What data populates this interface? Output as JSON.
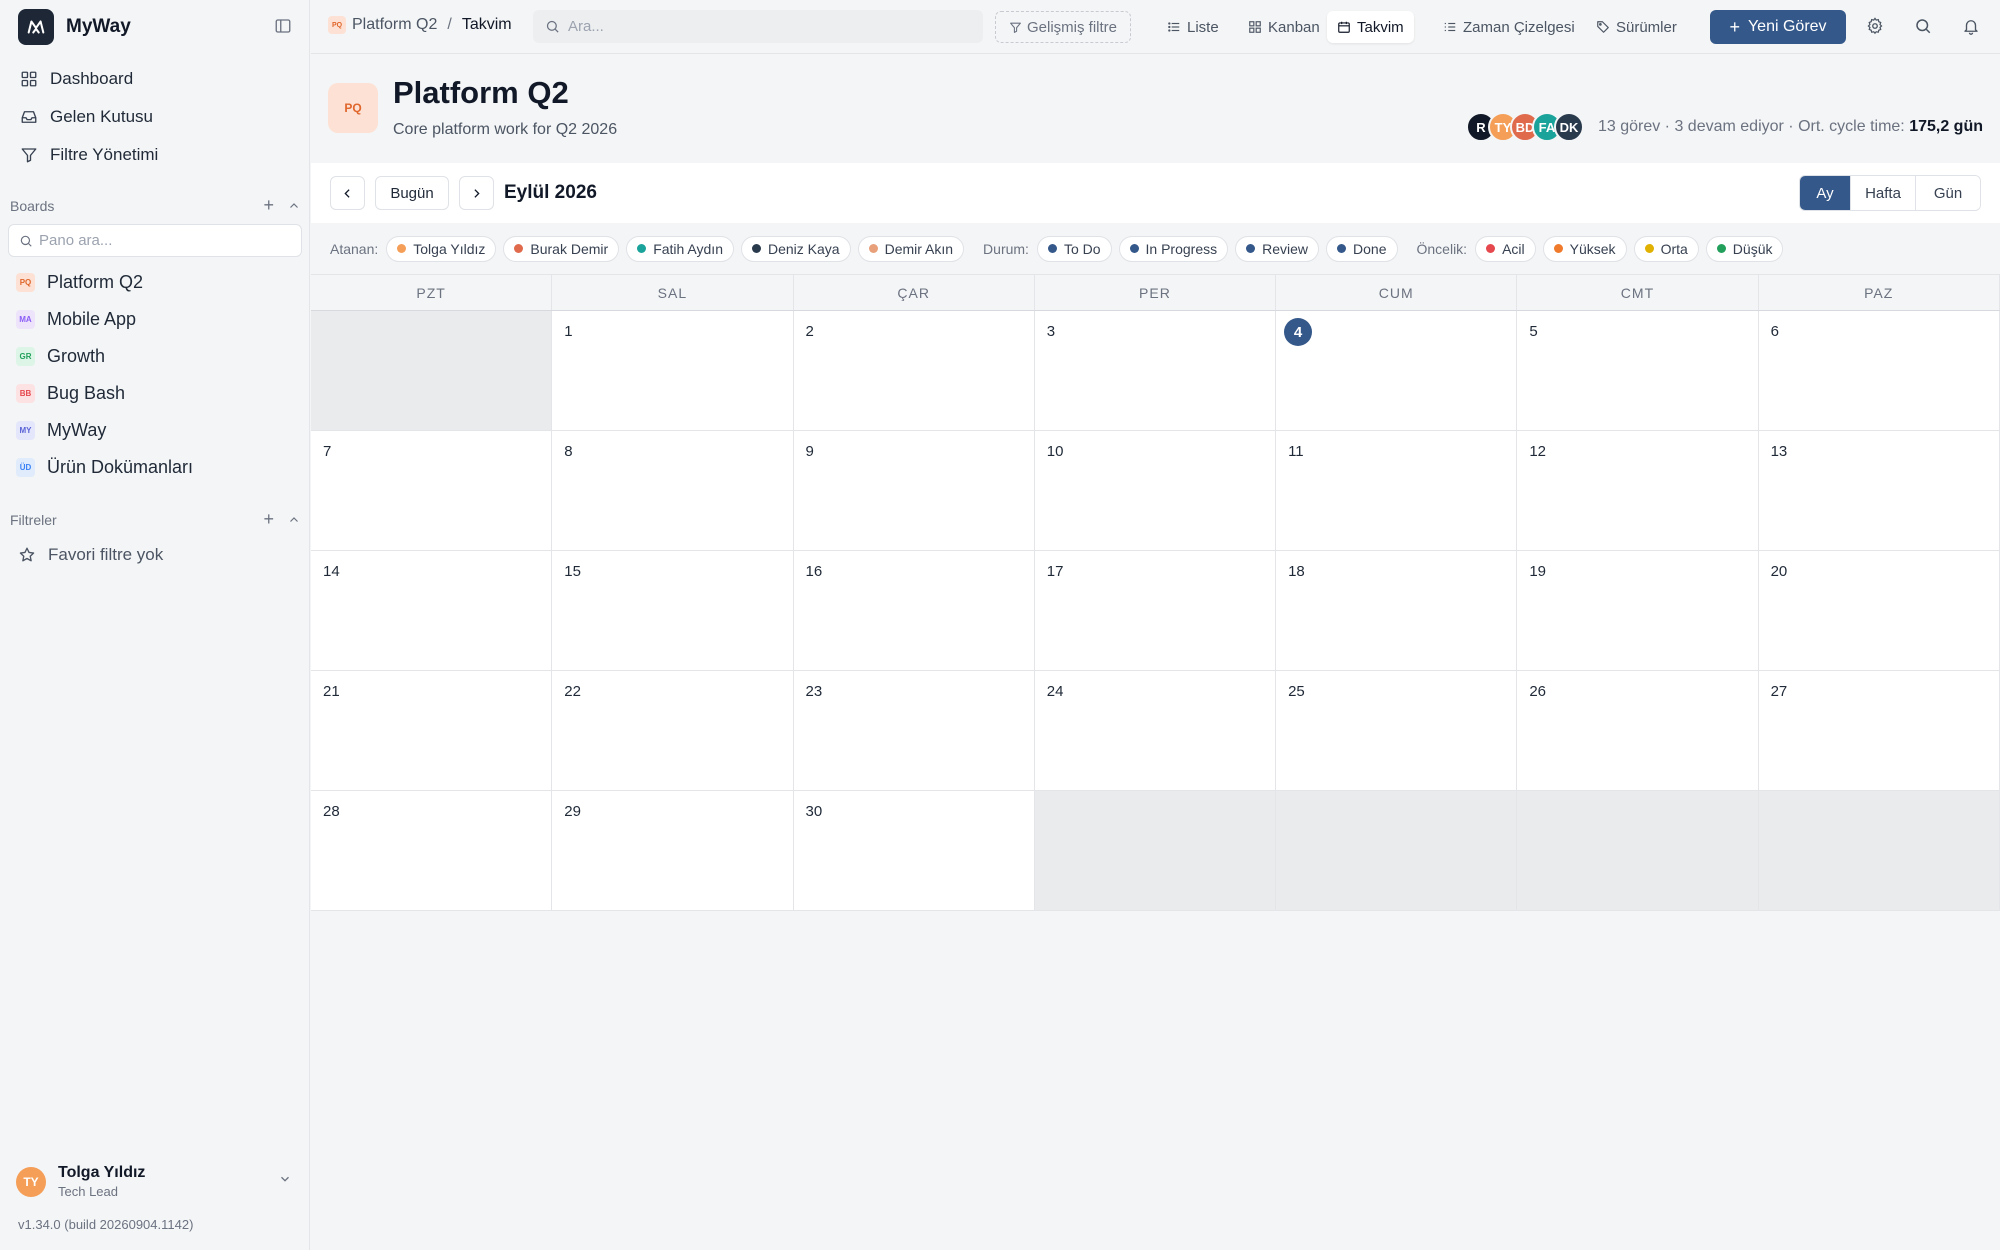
{
  "brand": {
    "name": "MyWay"
  },
  "nav": [
    {
      "label": "Dashboard",
      "icon": "grid-icon"
    },
    {
      "label": "Gelen Kutusu",
      "icon": "inbox-icon"
    },
    {
      "label": "Filtre Yönetimi",
      "icon": "filter-icon"
    }
  ],
  "boards_section": {
    "title": "Boards",
    "search_placeholder": "Pano ara..."
  },
  "boards": [
    {
      "code": "PQ",
      "label": "Platform Q2",
      "bg": "#fde1d4",
      "fg": "#e0662b"
    },
    {
      "code": "MA",
      "label": "Mobile App",
      "bg": "#ede4fb",
      "fg": "#8b5cf6"
    },
    {
      "code": "GR",
      "label": "Growth",
      "bg": "#dcf5e7",
      "fg": "#22a05b"
    },
    {
      "code": "BB",
      "label": "Bug Bash",
      "bg": "#fde2e4",
      "fg": "#e5484d"
    },
    {
      "code": "MY",
      "label": "MyWay",
      "bg": "#e4e7fb",
      "fg": "#5b63d6"
    },
    {
      "code": "ÜD",
      "label": "Ürün Dokümanları",
      "bg": "#e0ecfb",
      "fg": "#3b82f6"
    }
  ],
  "filters_section": {
    "title": "Filtreler",
    "empty": "Favori filtre yok"
  },
  "user": {
    "initials": "TY",
    "name": "Tolga Yıldız",
    "role": "Tech Lead"
  },
  "version": "v1.34.0 (build 20260904.1142)",
  "topbar": {
    "crumb_code": "PQ",
    "crumb_project": "Platform Q2",
    "crumb_sep": "/",
    "crumb_current": "Takvim",
    "search_placeholder": "Ara...",
    "advanced_filter": "Gelişmiş filtre",
    "tabs": [
      "Liste",
      "Kanban",
      "Takvim",
      "Zaman Çizelgesi",
      "Sürümler"
    ],
    "active_tab": "Takvim",
    "new_task": "Yeni Görev"
  },
  "project": {
    "code": "PQ",
    "title": "Platform Q2",
    "subtitle": "Core platform work for Q2 2026",
    "members": [
      {
        "initials": "R",
        "color": "#111827"
      },
      {
        "initials": "TY",
        "color": "#f59e57"
      },
      {
        "initials": "BD",
        "color": "#e06a4c"
      },
      {
        "initials": "FA",
        "color": "#1aa39a"
      },
      {
        "initials": "DK",
        "color": "#2a3a4d"
      }
    ],
    "stats_text": "13 görev · 3 devam ediyor · Ort. cycle time: ",
    "cycle_time": "175,2 gün"
  },
  "calendar": {
    "today_button": "Bugün",
    "month_label": "Eylül 2026",
    "views": [
      "Ay",
      "Hafta",
      "Gün"
    ],
    "active_view": "Ay",
    "weekdays": [
      "PZT",
      "SAL",
      "ÇAR",
      "PER",
      "CUM",
      "CMT",
      "PAZ"
    ],
    "first_weekday_offset": 1,
    "days_in_month": 30,
    "today": 4
  },
  "filters": {
    "assignee_label": "Atanan:",
    "assignees": [
      {
        "label": "Tolga Yıldız",
        "color": "#f59e57"
      },
      {
        "label": "Burak Demir",
        "color": "#e06a4c"
      },
      {
        "label": "Fatih Aydın",
        "color": "#1aa39a"
      },
      {
        "label": "Deniz Kaya",
        "color": "#2a3a4d"
      },
      {
        "label": "Demir Akın",
        "color": "#e8a07a"
      }
    ],
    "status_label": "Durum:",
    "statuses": [
      {
        "label": "To Do",
        "color": "#34588a"
      },
      {
        "label": "In Progress",
        "color": "#34588a"
      },
      {
        "label": "Review",
        "color": "#34588a"
      },
      {
        "label": "Done",
        "color": "#34588a"
      }
    ],
    "priority_label": "Öncelik:",
    "priorities": [
      {
        "label": "Acil",
        "color": "#e5484d"
      },
      {
        "label": "Yüksek",
        "color": "#f07a2b"
      },
      {
        "label": "Orta",
        "color": "#e0b100"
      },
      {
        "label": "Düşük",
        "color": "#22a05b"
      }
    ]
  }
}
